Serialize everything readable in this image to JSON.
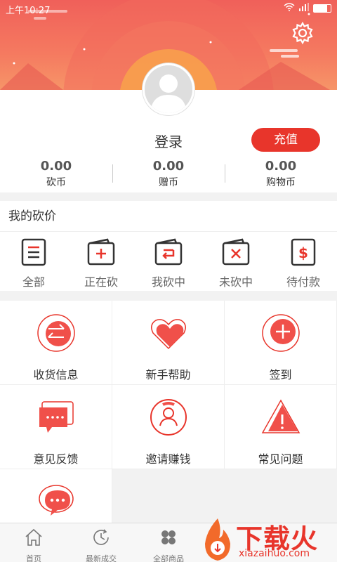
{
  "status_bar": {
    "time": "上午10:27"
  },
  "profile": {
    "login_label": "登录",
    "recharge_label": "充值"
  },
  "stats": [
    {
      "value": "0.00",
      "label": "砍币"
    },
    {
      "value": "0.00",
      "label": "赠币"
    },
    {
      "value": "0.00",
      "label": "购物币"
    }
  ],
  "bargain": {
    "title": "我的砍价",
    "items": [
      {
        "label": "全部",
        "icon": "list-icon"
      },
      {
        "label": "正在砍",
        "icon": "wallet-plus-icon"
      },
      {
        "label": "我砍中",
        "icon": "wallet-return-icon"
      },
      {
        "label": "未砍中",
        "icon": "wallet-x-icon"
      },
      {
        "label": "待付款",
        "icon": "wallet-dollar-icon"
      }
    ]
  },
  "grid": [
    {
      "label": "收货信息",
      "icon": "exchange-icon"
    },
    {
      "label": "新手帮助",
      "icon": "heart-tag-icon"
    },
    {
      "label": "签到",
      "icon": "plus-circle-icon"
    },
    {
      "label": "意见反馈",
      "icon": "feedback-icon"
    },
    {
      "label": "邀请赚钱",
      "icon": "user-icon"
    },
    {
      "label": "常见问题",
      "icon": "warning-icon"
    },
    {
      "label": "",
      "icon": "chat-icon"
    }
  ],
  "tabbar": [
    {
      "label": "首页",
      "icon": "home-icon"
    },
    {
      "label": "最新成交",
      "icon": "clock-icon"
    },
    {
      "label": "全部商品",
      "icon": "grid-icon"
    }
  ],
  "watermark": {
    "title": "下载火",
    "subtitle": "xiazaihuo.com"
  },
  "colors": {
    "accent": "#e8352b",
    "header": "#f0605a"
  }
}
